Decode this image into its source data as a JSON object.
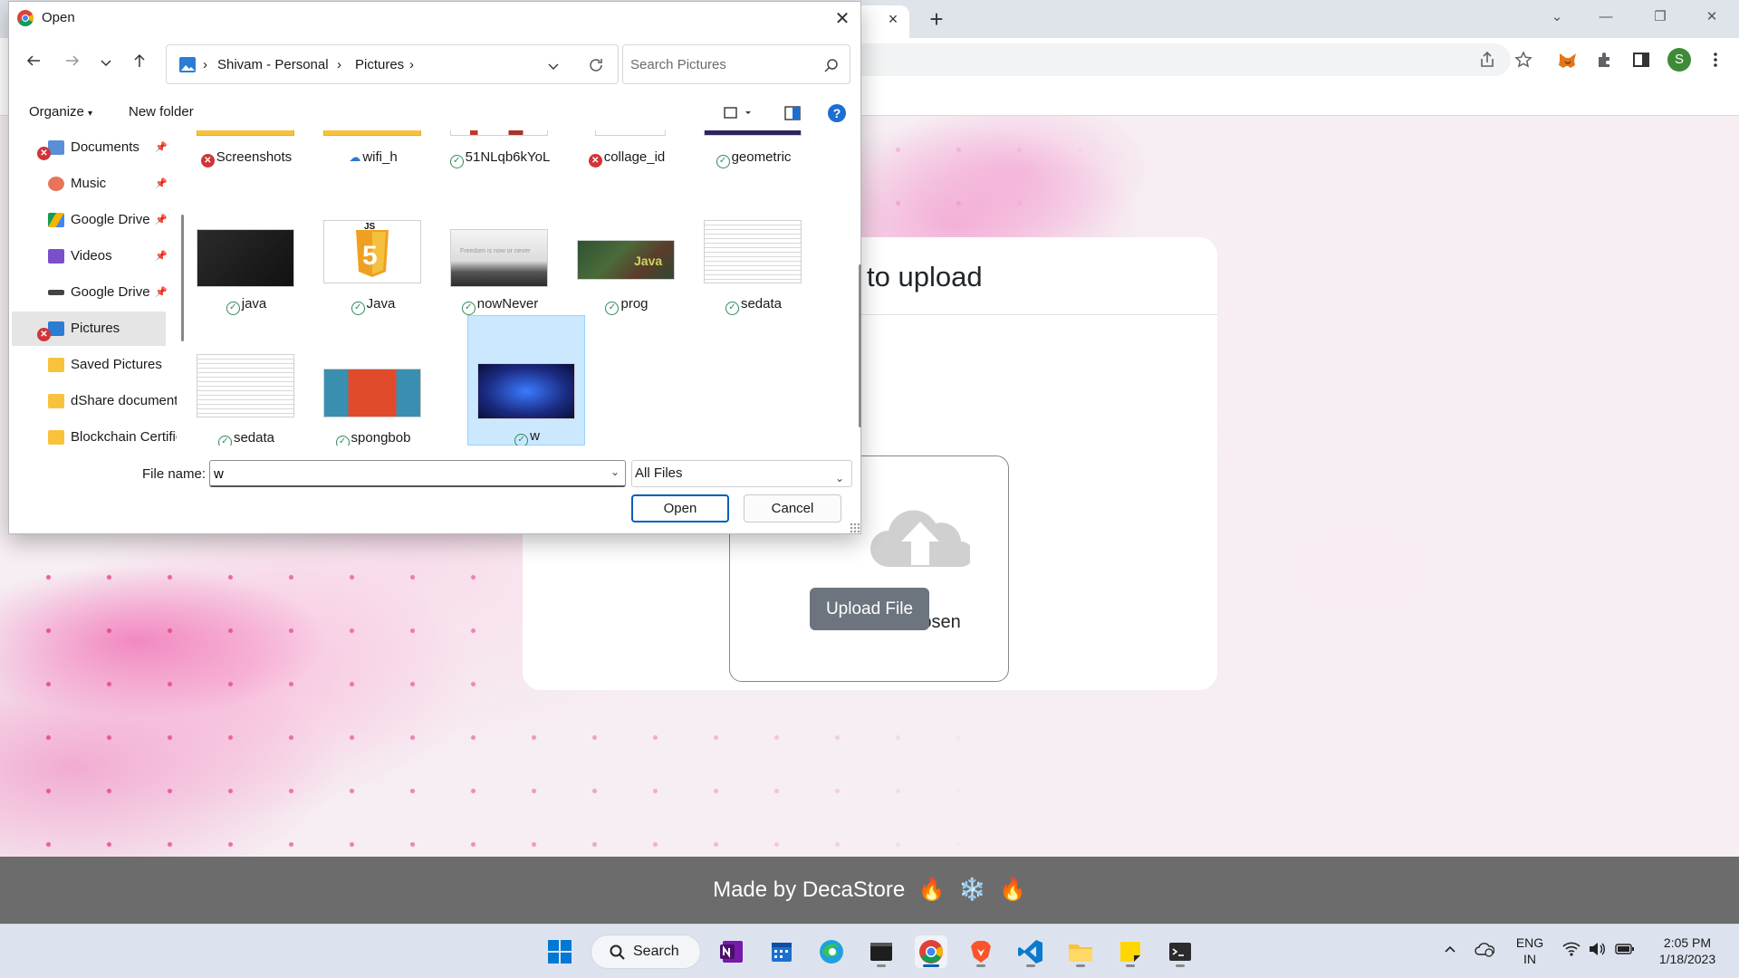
{
  "browser": {
    "tab_close": "×",
    "new_tab": "+",
    "window_controls": [
      "⌄",
      "—",
      "❐",
      "✕"
    ],
    "toolbar_icons": [
      "share-icon",
      "star-icon",
      "metamask-icon",
      "extensions-icon",
      "sidebar-icon",
      "profile-avatar",
      "menu-icon"
    ],
    "avatar_letter": "S"
  },
  "page": {
    "card_title": "to upload",
    "no_file": "No file chosen",
    "upload_button": "Upload File",
    "footer_text": "Made by DecaStore",
    "footer_emojis": [
      "🔥",
      "❄️",
      "🔥"
    ]
  },
  "dialog": {
    "title": "Open",
    "close": "✕",
    "breadcrumb": [
      "Shivam - Personal",
      "Pictures"
    ],
    "search_placeholder": "Search Pictures",
    "organize_label": "Organize",
    "new_folder_label": "New folder",
    "help": "?",
    "nav_items": [
      {
        "label": "Documents",
        "pinned": true,
        "error": true
      },
      {
        "label": "Music",
        "pinned": true,
        "error": false
      },
      {
        "label": "Google Drive",
        "pinned": true,
        "error": false
      },
      {
        "label": "Videos",
        "pinned": true,
        "error": false
      },
      {
        "label": "Google Drive",
        "pinned": true,
        "error": false
      },
      {
        "label": "Pictures",
        "pinned": false,
        "error": true,
        "selected": true
      },
      {
        "label": "Saved Pictures",
        "pinned": false,
        "error": false
      },
      {
        "label": "dShare documents",
        "pinned": false,
        "error": false
      },
      {
        "label": "Blockchain Certificates",
        "pinned": false,
        "error": false
      }
    ],
    "files": [
      {
        "name": "Screenshots",
        "status": "error"
      },
      {
        "name": "wifi_h",
        "status": "cloud"
      },
      {
        "name": "51NLqb6kYoL",
        "status": "ok"
      },
      {
        "name": "collage_id",
        "status": "error"
      },
      {
        "name": "geometric",
        "status": "ok"
      },
      {
        "name": "java",
        "status": "ok"
      },
      {
        "name": "Java",
        "status": "ok"
      },
      {
        "name": "nowNever",
        "status": "ok"
      },
      {
        "name": "prog",
        "status": "ok"
      },
      {
        "name": "sedata",
        "status": "ok"
      },
      {
        "name": "sedata",
        "status": "ok"
      },
      {
        "name": "spongbob",
        "status": "ok"
      },
      {
        "name": "w",
        "status": "ok",
        "selected": true
      }
    ],
    "thumb_texts": {
      "js": "JS",
      "java_word": "Java",
      "freedom": "Freedom is now or never"
    },
    "file_name_label": "File name:",
    "file_name_value": "w",
    "file_type": "All Files",
    "open_button": "Open",
    "cancel_button": "Cancel"
  },
  "taskbar": {
    "search_label": "Search",
    "lang_line1": "ENG",
    "lang_line2": "IN",
    "time": "2:05 PM",
    "date": "1/18/2023"
  },
  "colors": {
    "upload_button": "#6c757d",
    "footer": "#6c6c6c",
    "dialog_accent": "#005fb8",
    "selection": "#cce8ff",
    "ok_status": "#2e8b57",
    "error_status": "#d13438"
  }
}
